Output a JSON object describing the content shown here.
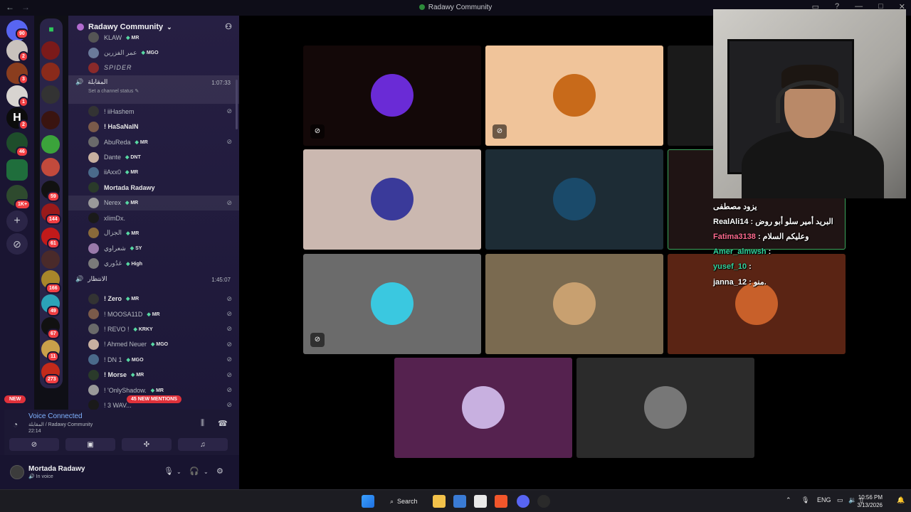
{
  "window": {
    "title": "Radawy Community",
    "controls": [
      "—",
      "□",
      "✕"
    ]
  },
  "server_rail": {
    "badges": [
      "90",
      "2",
      "3",
      "1",
      "1",
      "2",
      "46",
      "1K+",
      "59",
      "144",
      "61",
      "166",
      "49",
      "67",
      "11",
      "273"
    ]
  },
  "server": {
    "name": "Radawy Community"
  },
  "channels": {
    "top_partial_users": [
      {
        "name": "KLAW",
        "tag": "MR"
      },
      {
        "name": "عمر الفزرين",
        "tag": "MGO"
      },
      {
        "name": "SPIDER",
        "tag": ""
      }
    ],
    "voice_1": {
      "name": "المقابلة",
      "status": "Set a channel status",
      "time": "1:07:33",
      "users": [
        {
          "name": "! iiHashem",
          "tag": "",
          "muted": true
        },
        {
          "name": "! HaSaNaIN",
          "tag": "",
          "muted": false
        },
        {
          "name": "AbuReda",
          "tag": "MR",
          "muted": true
        },
        {
          "name": "Dante",
          "tag": "DNT",
          "muted": false
        },
        {
          "name": "iiAxx0",
          "tag": "MR",
          "muted": false
        },
        {
          "name": "Mortada Radawy",
          "tag": "",
          "muted": false
        },
        {
          "name": "Nerex",
          "tag": "MR",
          "muted": true
        },
        {
          "name": "xIimDx.",
          "tag": "",
          "muted": false
        },
        {
          "name": "الجزال",
          "tag": "MR",
          "muted": false
        },
        {
          "name": "شعراوي",
          "tag": "SY",
          "muted": false
        },
        {
          "name": "غدُوري",
          "tag": "High",
          "muted": false
        }
      ]
    },
    "voice_2": {
      "name": "الانتظار",
      "time": "1:45:07",
      "users": [
        {
          "name": "! Zero",
          "tag": "MR",
          "muted": true
        },
        {
          "name": "! MOOSA11D",
          "tag": "MR",
          "muted": true
        },
        {
          "name": "! REVO !",
          "tag": "KRKY",
          "muted": true
        },
        {
          "name": "! Ahmed Neuer",
          "tag": "MGO",
          "muted": true
        },
        {
          "name": "! DN 1",
          "tag": "MGO",
          "muted": true
        },
        {
          "name": "! Morse",
          "tag": "MR",
          "muted": true
        },
        {
          "name": "! 'OnlyShadow.",
          "tag": "MR",
          "muted": true
        },
        {
          "name": "! 3 WAV...",
          "tag": "",
          "muted": true
        }
      ]
    },
    "new_pill": "NEW",
    "mentions_pill": "45 NEW MENTIONS"
  },
  "voice_connected": {
    "title": "Voice Connected",
    "subtitle": "المقابلة / Radawy Community",
    "timer": "22:14"
  },
  "user_panel": {
    "name": "Mortada Radawy",
    "status": "In voice"
  },
  "stage": {
    "tiles": [
      {
        "bg": "#130808",
        "avatar": "H-logo",
        "muted": true
      },
      {
        "bg": "#f0c49a",
        "avatar": "pumpkin",
        "muted": true
      },
      {
        "bg": "#1a1a1a",
        "avatar": "",
        "muted": false
      },
      {
        "bg": "#cbb8b0",
        "avatar": "penguin",
        "muted": false
      },
      {
        "bg": "#1d2c35",
        "avatar": "man-suit",
        "muted": false
      },
      {
        "bg": "#1f1414",
        "avatar": "",
        "muted": false
      },
      {
        "bg": "#6b6b6b",
        "avatar": "snow-portal",
        "muted": true
      },
      {
        "bg": "#7a6a50",
        "avatar": "field",
        "muted": false
      },
      {
        "bg": "#5a2414",
        "avatar": "REVL",
        "muted": false
      },
      {
        "bg": "#55224f",
        "avatar": "anime",
        "muted": false
      },
      {
        "bg": "#2b2b2b",
        "avatar": "mask",
        "muted": false
      }
    ]
  },
  "stream_chat": [
    {
      "user": "",
      "text": "يزود مصطفى",
      "color": "#ffffff"
    },
    {
      "user": "RealAli14",
      "text": ": البريد أمير سلو أبو روض",
      "color": "#ffffff"
    },
    {
      "user": "Fatima3138",
      "text": ": وعليكم السلام",
      "color": "#ff6b8f"
    },
    {
      "user": "Amer_almwsh",
      "text": ":",
      "color": "#34d29c"
    },
    {
      "user": "yusef_10",
      "text": ":",
      "color": "#34d29c"
    },
    {
      "user": "janna_12",
      "text": ": منو.",
      "color": "#ffffff"
    }
  ],
  "taskbar": {
    "search": "Search",
    "lang": "ENG",
    "time": "10:56 PM",
    "date": "3/13/2026"
  }
}
